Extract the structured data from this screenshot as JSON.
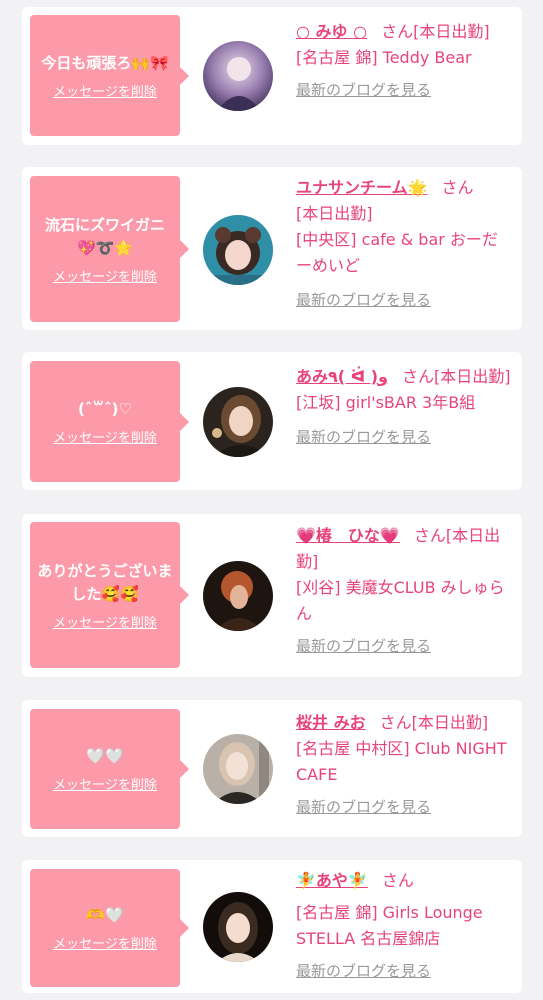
{
  "delete_label": "メッセージを削除",
  "blog_label": "最新のブログを見る",
  "cards": [
    {
      "message": "今日も頑張ろ🙌🎀",
      "name": "○ みゆ ○",
      "san": "さん",
      "shift": "[本日出勤]",
      "detail": "[名古屋 錦] Teddy Bear"
    },
    {
      "message": "流石にズワイガニ💖➰🌟",
      "name": "ユナサンチーム🌟",
      "san": "さん",
      "shift": "[本日出勤]",
      "detail": "[中央区] cafe & bar おーだーめいど"
    },
    {
      "message": "(ˆ꒳ˆ)♡",
      "name": "あみ٩( ᐛ )و",
      "san": "さん",
      "shift": "[本日出勤]",
      "detail": "[江坂] girl'sBAR 3年B組"
    },
    {
      "message": "ありがとうございました🥰🥰",
      "name": "💗椿　ひな💗",
      "san": "さん",
      "shift": "[本日出勤]",
      "detail": "[刈谷] 美魔女CLUB みしゅらん"
    },
    {
      "message": "🤍🤍",
      "name": "桜井 みお",
      "san": "さん",
      "shift": "[本日出勤]",
      "detail": "[名古屋 中村区] Club NIGHT CAFE"
    },
    {
      "message": "🫶🤍",
      "name": "🧚あや🧚",
      "san": "さん",
      "shift": "",
      "detail": "[名古屋 錦] Girls Lounge STELLA 名古屋錦店"
    }
  ]
}
